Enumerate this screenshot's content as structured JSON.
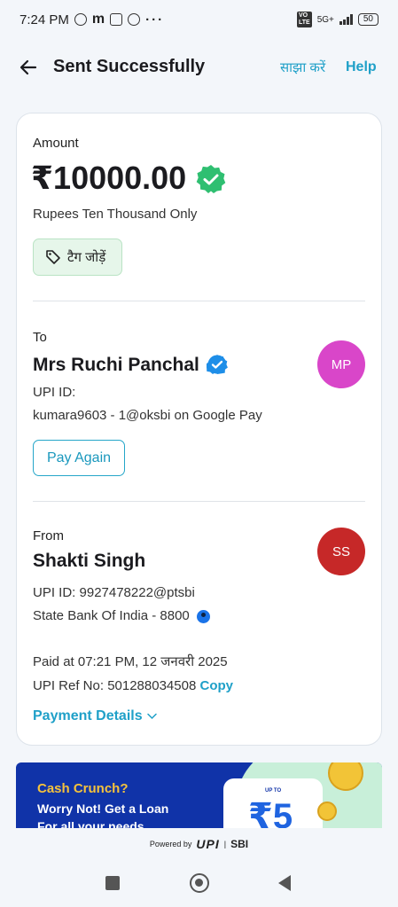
{
  "status_bar": {
    "time": "7:24 PM",
    "dots": "···",
    "network": "5G+",
    "battery": "50"
  },
  "header": {
    "title": "Sent Successfully",
    "share_label": "साझा करें",
    "help_label": "Help"
  },
  "amount_section": {
    "label": "Amount",
    "amount": "₹10000.00",
    "in_words": "Rupees Ten Thousand Only",
    "tag_label": "टैग जोड़ें"
  },
  "to_section": {
    "label": "To",
    "name": "Mrs Ruchi Panchal",
    "upi_label": "UPI ID:",
    "upi_value": "kumara9603 - 1@oksbi on Google Pay",
    "avatar_initials": "MP",
    "avatar_color": "#d946c9",
    "pay_again_label": "Pay Again"
  },
  "from_section": {
    "label": "From",
    "name": "Shakti Singh",
    "avatar_initials": "SS",
    "avatar_color": "#c62828",
    "upi_line": "UPI ID: 9927478222@ptsbi",
    "bank_line": "State Bank Of India - 8800",
    "paid_at": "Paid at 07:21 PM, 12 जनवरी 2025",
    "ref_prefix": "UPI Ref No: 501288034508",
    "copy_label": "Copy",
    "payment_details_label": "Payment Details"
  },
  "banner": {
    "title": "Cash Crunch?",
    "line1": "Worry Not! Get a Loan",
    "line2": "For all your needs",
    "upto": "UP TO",
    "amount": "₹5"
  },
  "footer": {
    "powered_by": "Powered by",
    "upi": "UPI",
    "sbi": "SBI"
  },
  "colors": {
    "accent": "#1fa0c8",
    "success_green": "#2fbf71",
    "verified_blue": "#1e8ee8"
  }
}
